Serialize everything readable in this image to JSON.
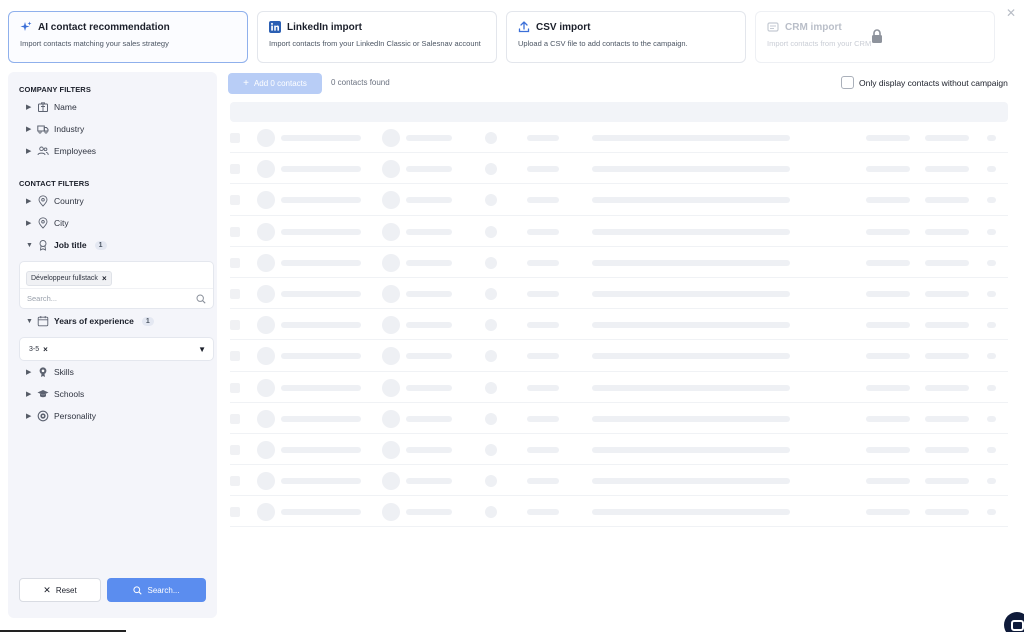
{
  "cards": [
    {
      "title": "AI contact recommendation",
      "desc": "Import contacts matching your sales strategy",
      "icon": "sparkle-icon",
      "state": "active"
    },
    {
      "title": "LinkedIn import",
      "desc": "Import contacts from your LinkedIn Classic or Salesnav account",
      "icon": "linkedin-icon",
      "state": "normal"
    },
    {
      "title": "CSV import",
      "desc": "Upload a CSV file to add contacts to the campaign.",
      "icon": "upload-icon",
      "state": "normal"
    },
    {
      "title": "CRM import",
      "desc": "Import contacts from your CRM",
      "icon": "lock-icon",
      "state": "disabled"
    }
  ],
  "company_filters": {
    "title": "COMPANY FILTERS",
    "items": [
      {
        "label": "Name",
        "icon": "building-icon"
      },
      {
        "label": "Industry",
        "icon": "truck-icon"
      },
      {
        "label": "Employees",
        "icon": "people-icon"
      }
    ]
  },
  "contact_filters": {
    "title": "CONTACT FILTERS",
    "items": [
      {
        "label": "Country",
        "icon": "location-pin-icon"
      },
      {
        "label": "City",
        "icon": "location-pin-icon"
      }
    ],
    "job_title": {
      "label": "Job title",
      "count": "1",
      "chip": "Développeur fullstack",
      "placeholder": "Search..."
    },
    "experience": {
      "label": "Years of experience",
      "count": "1",
      "chip": "3-5"
    },
    "more": [
      {
        "label": "Skills",
        "icon": "badge-icon"
      },
      {
        "label": "Schools",
        "icon": "graduation-cap-icon"
      },
      {
        "label": "Personality",
        "icon": "target-icon"
      }
    ]
  },
  "buttons": {
    "reset": "Reset",
    "search": "Search...",
    "add": "Add 0 contacts"
  },
  "status": {
    "found": "0 contacts found",
    "only_without_campaign": "Only display contacts without campaign"
  },
  "colors": {
    "accent": "#5b8def",
    "accent_disabled": "#b8cdf6",
    "sidebar_bg": "#f4f5fa",
    "skeleton": "#eef0f4"
  }
}
